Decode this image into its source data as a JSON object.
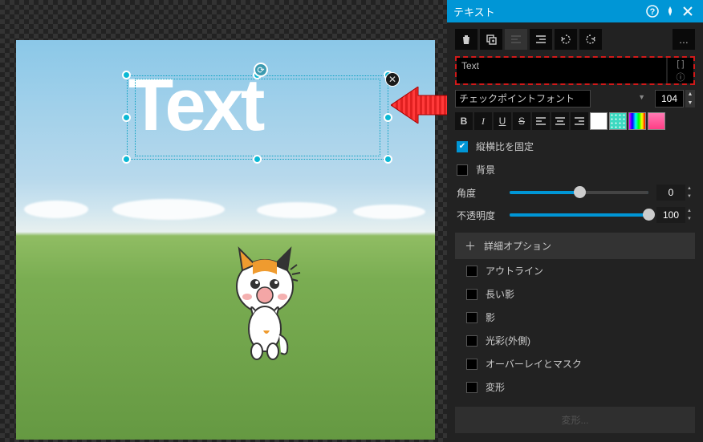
{
  "panel": {
    "title": "テキスト",
    "help_icon": "help",
    "pin_icon": "pin",
    "close_icon": "close"
  },
  "toolbar": {
    "delete": "delete",
    "copy": "copy",
    "layer": "layer",
    "align_left": "align-left",
    "align_right": "align-right",
    "rotate_ccw": "rotate-ccw",
    "rotate_cw": "rotate-cw",
    "more": "..."
  },
  "text_input": {
    "value": "Text",
    "brackets": "[  ]",
    "info": "ⓘ"
  },
  "font": {
    "selected": "チェックポイントフォント",
    "size": "104"
  },
  "style": {
    "bold": "B",
    "italic": "I",
    "underline": "U",
    "strike": "S",
    "align_l": "≡",
    "align_c": "≡",
    "align_r": "≡",
    "color_white": "#ffffff",
    "color_dots": "dots",
    "color_rainbow": "rainbow",
    "color_pink": "#ff4da6"
  },
  "props": {
    "lock_ratio": "縦横比を固定",
    "background": "背景",
    "angle_label": "角度",
    "angle_value": "0",
    "opacity_label": "不透明度",
    "opacity_value": "100"
  },
  "advanced": {
    "header": "詳細オプション",
    "outline": "アウトライン",
    "long_shadow": "長い影",
    "shadow": "影",
    "outer_glow": "光彩(外側)",
    "overlay_mask": "オーバーレイとマスク",
    "deform": "変形",
    "deform_btn": "変形..."
  },
  "canvas": {
    "text": "Text"
  }
}
